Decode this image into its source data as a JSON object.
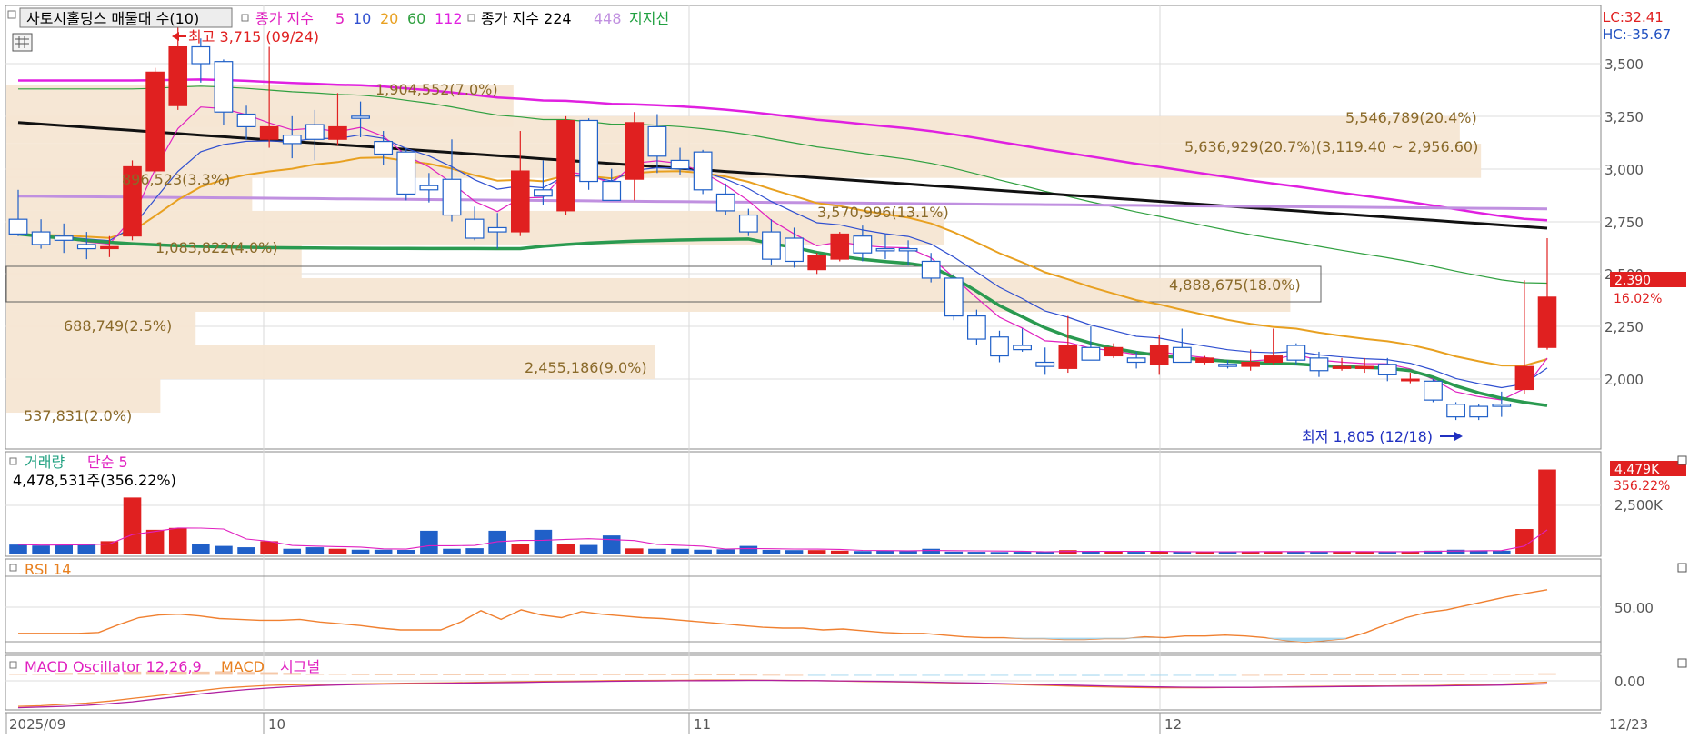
{
  "price_pane": {
    "title": "사토시홀딩스 매물대 수(10)",
    "ma_prefix": "종가 지수",
    "ma_items": [
      {
        "label": "5",
        "color": "#e020c0"
      },
      {
        "label": "10",
        "color": "#3050d0"
      },
      {
        "label": "20",
        "color": "#e8a020"
      },
      {
        "label": "60",
        "color": "#30a040"
      },
      {
        "label": "112",
        "color": "#e020e0"
      }
    ],
    "ma224_label": "종가 지수 224",
    "ma448_label": "448",
    "support_label": "지지선",
    "high_label": "최고 3,715 (09/24)",
    "low_label": "최저 1,805 (12/18)",
    "lc_label": "LC:32.41",
    "hc_label": "HC:-35.67",
    "current_price": "2,390",
    "current_change": "16.02%",
    "y_ticks": [
      "3,500",
      "3,250",
      "3,000",
      "2,750",
      "2,500",
      "2,250",
      "2,000"
    ],
    "profile_labels": [
      "1,904,552(7.0%)",
      "5,546,789(20.4%)",
      "5,636,929(20.7%)(3,119.40 ~ 2,956.60)",
      "896,523(3.3%)",
      "3,570,996(13.1%)",
      "1,083,822(4.0%)",
      "4,888,675(18.0%)",
      "688,749(2.5%)",
      "2,455,186(9.0%)",
      "537,831(2.0%)"
    ]
  },
  "volume_pane": {
    "title": "거래량",
    "ma_label": "단순 5",
    "value_label": "4,478,531주(356.22%)",
    "current_value": "4,479K",
    "current_change": "356.22%",
    "y_tick": "2,500K"
  },
  "rsi_pane": {
    "title": "RSI 14",
    "y_tick": "50.00"
  },
  "macd_pane": {
    "title": "MACD Oscillator 12,26,9",
    "macd_label": "MACD",
    "signal_label": "시그널",
    "y_tick": "0.00"
  },
  "x_axis": {
    "labels": [
      "2025/09",
      "10",
      "11",
      "12",
      "12/23"
    ]
  },
  "chart_data": {
    "type": "candlestick",
    "title": "사토시홀딩스",
    "price_range": [
      1700,
      3800
    ],
    "dates_start": "2025/09",
    "dates_end": "12/23",
    "candles": [
      {
        "o": 2760,
        "h": 2900,
        "l": 2680,
        "c": 2690,
        "up": false
      },
      {
        "o": 2700,
        "h": 2760,
        "l": 2620,
        "c": 2640,
        "up": false
      },
      {
        "o": 2680,
        "h": 2740,
        "l": 2600,
        "c": 2660,
        "up": false
      },
      {
        "o": 2640,
        "h": 2700,
        "l": 2570,
        "c": 2620,
        "up": false
      },
      {
        "o": 2630,
        "h": 2680,
        "l": 2580,
        "c": 2620,
        "up": true
      },
      {
        "o": 2680,
        "h": 3040,
        "l": 2660,
        "c": 3010,
        "up": true
      },
      {
        "o": 2990,
        "h": 3480,
        "l": 2980,
        "c": 3460,
        "up": true
      },
      {
        "o": 3300,
        "h": 3715,
        "l": 3280,
        "c": 3580,
        "up": true
      },
      {
        "o": 3580,
        "h": 3620,
        "l": 3410,
        "c": 3500,
        "up": false
      },
      {
        "o": 3510,
        "h": 3520,
        "l": 3210,
        "c": 3270,
        "up": false
      },
      {
        "o": 3260,
        "h": 3300,
        "l": 3140,
        "c": 3200,
        "up": false
      },
      {
        "o": 3200,
        "h": 3580,
        "l": 3100,
        "c": 3140,
        "up": true
      },
      {
        "o": 3160,
        "h": 3250,
        "l": 3050,
        "c": 3120,
        "up": false
      },
      {
        "o": 3140,
        "h": 3280,
        "l": 3040,
        "c": 3210,
        "up": false
      },
      {
        "o": 3200,
        "h": 3360,
        "l": 3110,
        "c": 3140,
        "up": true
      },
      {
        "o": 3250,
        "h": 3320,
        "l": 3150,
        "c": 3240,
        "up": false
      },
      {
        "o": 3130,
        "h": 3180,
        "l": 3020,
        "c": 3070,
        "up": false
      },
      {
        "o": 3080,
        "h": 3100,
        "l": 2850,
        "c": 2880,
        "up": false
      },
      {
        "o": 2920,
        "h": 2980,
        "l": 2840,
        "c": 2900,
        "up": false
      },
      {
        "o": 2950,
        "h": 3140,
        "l": 2750,
        "c": 2780,
        "up": false
      },
      {
        "o": 2760,
        "h": 2820,
        "l": 2660,
        "c": 2670,
        "up": false
      },
      {
        "o": 2720,
        "h": 2790,
        "l": 2620,
        "c": 2700,
        "up": false
      },
      {
        "o": 2700,
        "h": 3180,
        "l": 2680,
        "c": 2990,
        "up": true
      },
      {
        "o": 2900,
        "h": 3040,
        "l": 2830,
        "c": 2870,
        "up": false
      },
      {
        "o": 2800,
        "h": 3250,
        "l": 2780,
        "c": 3230,
        "up": true
      },
      {
        "o": 3230,
        "h": 3240,
        "l": 2900,
        "c": 2940,
        "up": false
      },
      {
        "o": 2940,
        "h": 3000,
        "l": 2870,
        "c": 2850,
        "up": false
      },
      {
        "o": 2950,
        "h": 3270,
        "l": 2850,
        "c": 3220,
        "up": true
      },
      {
        "o": 3200,
        "h": 3260,
        "l": 2980,
        "c": 3060,
        "up": false
      },
      {
        "o": 3040,
        "h": 3100,
        "l": 2970,
        "c": 3000,
        "up": false
      },
      {
        "o": 3080,
        "h": 3090,
        "l": 2880,
        "c": 2900,
        "up": false
      },
      {
        "o": 2880,
        "h": 2930,
        "l": 2780,
        "c": 2800,
        "up": false
      },
      {
        "o": 2780,
        "h": 2810,
        "l": 2680,
        "c": 2700,
        "up": false
      },
      {
        "o": 2700,
        "h": 2760,
        "l": 2540,
        "c": 2570,
        "up": false
      },
      {
        "o": 2670,
        "h": 2720,
        "l": 2530,
        "c": 2560,
        "up": false
      },
      {
        "o": 2590,
        "h": 2600,
        "l": 2500,
        "c": 2520,
        "up": true
      },
      {
        "o": 2570,
        "h": 2700,
        "l": 2560,
        "c": 2690,
        "up": true
      },
      {
        "o": 2680,
        "h": 2730,
        "l": 2560,
        "c": 2600,
        "up": false
      },
      {
        "o": 2620,
        "h": 2690,
        "l": 2570,
        "c": 2610,
        "up": false
      },
      {
        "o": 2610,
        "h": 2660,
        "l": 2540,
        "c": 2620,
        "up": false
      },
      {
        "o": 2560,
        "h": 2600,
        "l": 2460,
        "c": 2480,
        "up": false
      },
      {
        "o": 2480,
        "h": 2500,
        "l": 2280,
        "c": 2300,
        "up": false
      },
      {
        "o": 2300,
        "h": 2330,
        "l": 2160,
        "c": 2190,
        "up": false
      },
      {
        "o": 2200,
        "h": 2230,
        "l": 2080,
        "c": 2110,
        "up": false
      },
      {
        "o": 2160,
        "h": 2240,
        "l": 2130,
        "c": 2140,
        "up": false
      },
      {
        "o": 2080,
        "h": 2150,
        "l": 2020,
        "c": 2060,
        "up": false
      },
      {
        "o": 2050,
        "h": 2300,
        "l": 2030,
        "c": 2160,
        "up": true
      },
      {
        "o": 2150,
        "h": 2250,
        "l": 2090,
        "c": 2090,
        "up": false
      },
      {
        "o": 2150,
        "h": 2170,
        "l": 2100,
        "c": 2110,
        "up": true
      },
      {
        "o": 2100,
        "h": 2130,
        "l": 2050,
        "c": 2080,
        "up": false
      },
      {
        "o": 2070,
        "h": 2210,
        "l": 2020,
        "c": 2160,
        "up": true
      },
      {
        "o": 2150,
        "h": 2240,
        "l": 2120,
        "c": 2080,
        "up": false
      },
      {
        "o": 2100,
        "h": 2110,
        "l": 2070,
        "c": 2080,
        "up": true
      },
      {
        "o": 2070,
        "h": 2090,
        "l": 2050,
        "c": 2060,
        "up": false
      },
      {
        "o": 2060,
        "h": 2140,
        "l": 2040,
        "c": 2080,
        "up": true
      },
      {
        "o": 2080,
        "h": 2240,
        "l": 2070,
        "c": 2110,
        "up": true
      },
      {
        "o": 2090,
        "h": 2170,
        "l": 2070,
        "c": 2160,
        "up": false
      },
      {
        "o": 2100,
        "h": 2130,
        "l": 2010,
        "c": 2040,
        "up": false
      },
      {
        "o": 2050,
        "h": 2100,
        "l": 2040,
        "c": 2060,
        "up": true
      },
      {
        "o": 2050,
        "h": 2100,
        "l": 2030,
        "c": 2060,
        "up": true
      },
      {
        "o": 2020,
        "h": 2100,
        "l": 1990,
        "c": 2070,
        "up": false
      },
      {
        "o": 2000,
        "h": 2030,
        "l": 1980,
        "c": 2000,
        "up": true
      },
      {
        "o": 1990,
        "h": 2000,
        "l": 1890,
        "c": 1900,
        "up": false
      },
      {
        "o": 1880,
        "h": 1890,
        "l": 1805,
        "c": 1820,
        "up": false
      },
      {
        "o": 1820,
        "h": 1880,
        "l": 1805,
        "c": 1870,
        "up": false
      },
      {
        "o": 1880,
        "h": 1940,
        "l": 1820,
        "c": 1870,
        "up": false
      },
      {
        "o": 1950,
        "h": 2470,
        "l": 1930,
        "c": 2060,
        "up": true
      },
      {
        "o": 2150,
        "h": 2670,
        "l": 2140,
        "c": 2390,
        "up": true
      }
    ],
    "volume_profile": [
      {
        "lo": 3200,
        "hi": 3400,
        "vol": 1904552,
        "pct": 7.0
      },
      {
        "lo": 3120,
        "hi": 3250,
        "vol": 5546789,
        "pct": 20.4
      },
      {
        "lo": 2956.6,
        "hi": 3119.4,
        "vol": 5636929,
        "pct": 20.7
      },
      {
        "lo": 2800,
        "hi": 2960,
        "vol": 896523,
        "pct": 3.3
      },
      {
        "lo": 2640,
        "hi": 2800,
        "vol": 3570996,
        "pct": 13.1
      },
      {
        "lo": 2480,
        "hi": 2640,
        "vol": 1083822,
        "pct": 4.0
      },
      {
        "lo": 2320,
        "hi": 2480,
        "vol": 4888675,
        "pct": 18.0
      },
      {
        "lo": 2160,
        "hi": 2320,
        "vol": 688749,
        "pct": 2.5
      },
      {
        "lo": 2000,
        "hi": 2160,
        "vol": 2455186,
        "pct": 9.0
      },
      {
        "lo": 1840,
        "hi": 2000,
        "vol": 537831,
        "pct": 2.0
      }
    ],
    "volume_range": [
      0,
      4600000
    ],
    "volume": [
      520000,
      470000,
      500000,
      560000,
      700000,
      3000000,
      1300000,
      1400000,
      550000,
      450000,
      380000,
      700000,
      300000,
      380000,
      300000,
      250000,
      250000,
      240000,
      1250000,
      300000,
      330000,
      1250000,
      550000,
      1300000,
      550000,
      500000,
      1000000,
      320000,
      300000,
      300000,
      250000,
      270000,
      450000,
      240000,
      230000,
      230000,
      200000,
      180000,
      190000,
      180000,
      300000,
      150000,
      140000,
      130000,
      140000,
      150000,
      230000,
      160000,
      150000,
      140000,
      150000,
      150000,
      140000,
      150000,
      160000,
      170000,
      150000,
      140000,
      150000,
      150000,
      160000,
      150000,
      200000,
      250000,
      220000,
      200000,
      1340000,
      4478531
    ],
    "rsi_range": [
      0,
      100
    ],
    "rsi": [
      20,
      20,
      20,
      20,
      21,
      30,
      38,
      41,
      42,
      40,
      37,
      36,
      35,
      35,
      36,
      33,
      31,
      29,
      26,
      24,
      24,
      24,
      33,
      46,
      36,
      47,
      41,
      38,
      45,
      42,
      40,
      38,
      37,
      35,
      33,
      31,
      29,
      27,
      26,
      26,
      24,
      25,
      23,
      21,
      20,
      20,
      18,
      16,
      15,
      15,
      14,
      14,
      13,
      13,
      14,
      14,
      16,
      15,
      17,
      17,
      18,
      17,
      15,
      12,
      10,
      12,
      14,
      21,
      30,
      38,
      44,
      47,
      52,
      57,
      62,
      66,
      70
    ],
    "macd_range": [
      -260,
      100
    ],
    "macd": [
      -240,
      -235,
      -225,
      -215,
      -200,
      -180,
      -160,
      -140,
      -120,
      -100,
      -90,
      -80,
      -75,
      -72,
      -70,
      -68,
      -66,
      -64,
      -62,
      -60,
      -58,
      -55,
      -52,
      -50,
      -48,
      -46,
      -44,
      -43,
      -42,
      -41,
      -40,
      -40,
      -40,
      -41,
      -43,
      -45,
      -47,
      -50,
      -52,
      -55,
      -58,
      -62,
      -66,
      -70,
      -75,
      -80,
      -85,
      -90,
      -93,
      -96,
      -98,
      -98,
      -98,
      -96,
      -95,
      -93,
      -90,
      -88,
      -86,
      -85,
      -84,
      -83,
      -82,
      -78,
      -74,
      -70,
      -64,
      -56
    ],
    "signal": [
      -250,
      -245,
      -240,
      -232,
      -220,
      -205,
      -185,
      -165,
      -145,
      -128,
      -112,
      -100,
      -90,
      -82,
      -77,
      -73,
      -70,
      -68,
      -66,
      -64,
      -62,
      -60,
      -58,
      -55,
      -53,
      -51,
      -49,
      -47,
      -46,
      -45,
      -44,
      -43,
      -42,
      -42,
      -43,
      -44,
      -46,
      -48,
      -50,
      -53,
      -56,
      -59,
      -62,
      -66,
      -70,
      -74,
      -78,
      -82,
      -86,
      -89,
      -92,
      -94,
      -95,
      -95,
      -95,
      -94,
      -93,
      -91,
      -89,
      -88,
      -87,
      -86,
      -85,
      -83,
      -81,
      -78,
      -74,
      -68
    ],
    "oscillator": [
      10,
      10,
      15,
      17,
      20,
      25,
      25,
      25,
      25,
      28,
      22,
      20,
      15,
      10,
      7,
      5,
      4,
      4,
      4,
      4,
      4,
      5,
      6,
      5,
      5,
      5,
      5,
      4,
      4,
      4,
      4,
      3,
      2,
      1,
      0,
      -1,
      -1,
      -2,
      -2,
      -2,
      -2,
      -3,
      -4,
      -4,
      -5,
      -6,
      -7,
      -8,
      -7,
      -7,
      -6,
      -4,
      -3,
      -1,
      0,
      1,
      3,
      3,
      3,
      3,
      3,
      3,
      3,
      5,
      7,
      8,
      10,
      12
    ]
  }
}
